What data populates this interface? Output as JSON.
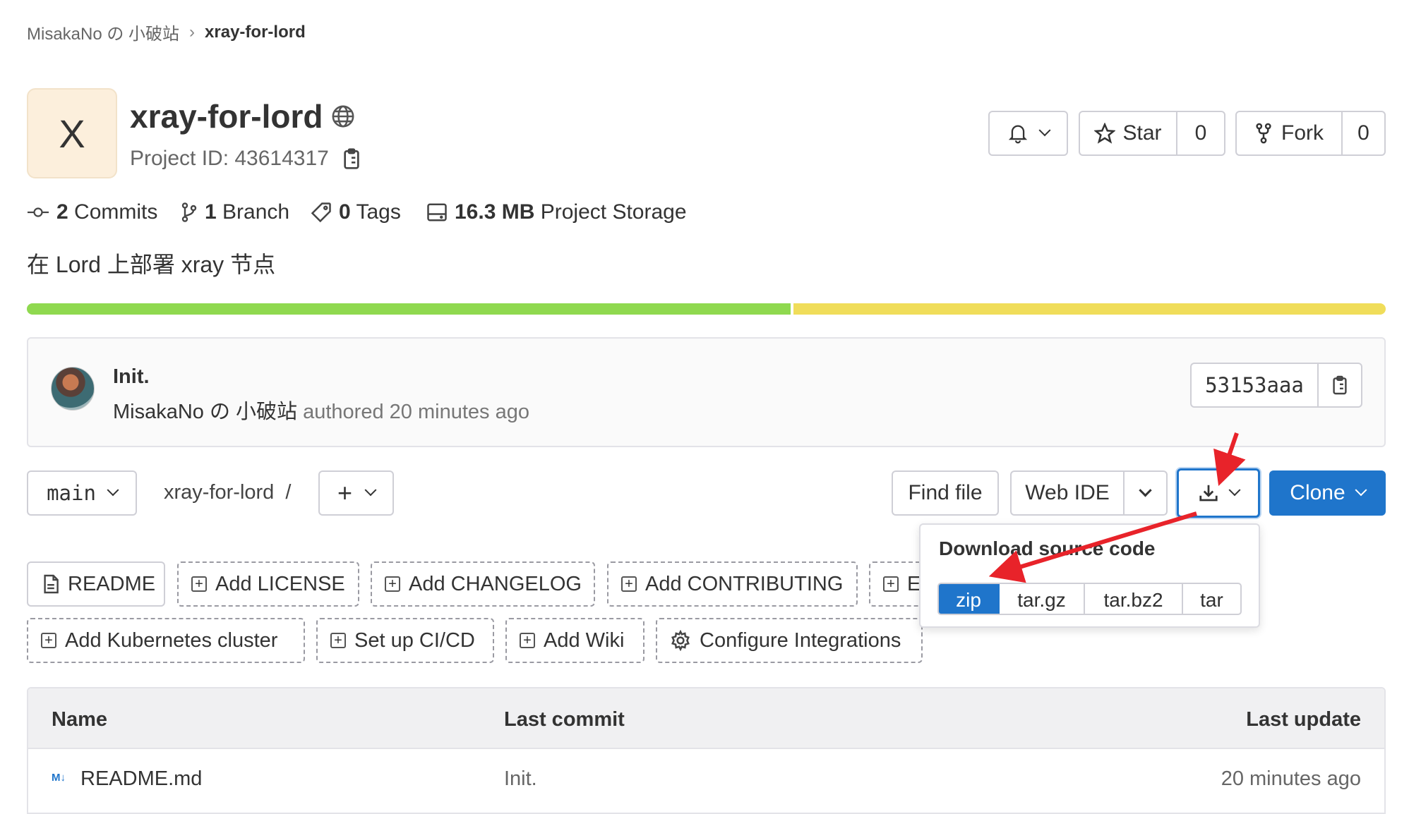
{
  "breadcrumb": {
    "group": "MisakaNo の 小破站",
    "separator": "›",
    "project": "xray-for-lord"
  },
  "project": {
    "avatar_letter": "X",
    "name": "xray-for-lord",
    "id_label": "Project ID: 43614317",
    "description": "在 Lord 上部署 xray 节点"
  },
  "actions": {
    "star_label": "Star",
    "star_count": "0",
    "fork_label": "Fork",
    "fork_count": "0"
  },
  "stats": {
    "commits_count": "2",
    "commits_label": "Commits",
    "branch_count": "1",
    "branch_label": "Branch",
    "tags_count": "0",
    "tags_label": "Tags",
    "storage_size": "16.3 MB",
    "storage_label": "Project Storage"
  },
  "language_bar": [
    {
      "color": "#8fd94f",
      "fraction": 0.563
    },
    {
      "color": "#f0dd5a",
      "fraction": 0.437
    }
  ],
  "last_commit": {
    "title": "Init.",
    "author": "MisakaNo の 小破站",
    "meta": "authored 20 minutes ago",
    "sha": "53153aaa"
  },
  "toolbar": {
    "branch": "main",
    "path": "xray-for-lord",
    "path_sep": "/",
    "find_file": "Find file",
    "web_ide": "Web IDE",
    "clone": "Clone"
  },
  "download": {
    "title": "Download source code",
    "formats": [
      "zip",
      "tar.gz",
      "tar.bz2",
      "tar"
    ],
    "selected": "zip"
  },
  "shortcuts": {
    "readme": "README",
    "add_license": "Add LICENSE",
    "add_changelog": "Add CHANGELOG",
    "add_contributing": "Add CONTRIBUTING",
    "partial": "E",
    "add_k8s": "Add Kubernetes cluster",
    "setup_cicd": "Set up CI/CD",
    "add_wiki": "Add Wiki",
    "configure_integrations": "Configure Integrations"
  },
  "file_table": {
    "headers": {
      "name": "Name",
      "last_commit": "Last commit",
      "last_update": "Last update"
    },
    "rows": [
      {
        "name": "README.md",
        "commit": "Init.",
        "updated": "20 minutes ago"
      }
    ]
  },
  "colors": {
    "accent": "#1f75cb",
    "arrow": "#e8232a"
  }
}
